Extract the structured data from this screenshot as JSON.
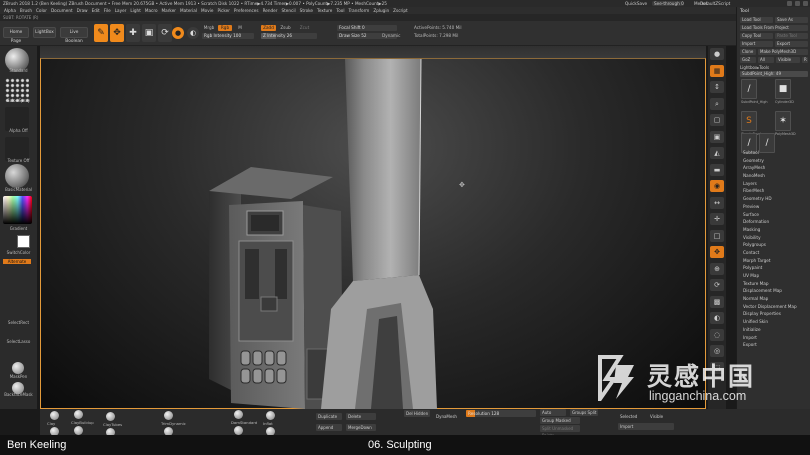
{
  "window": {
    "title": "ZBrush 2018 1.2 (Ben Keeling)  ZBrush Document  • Free Mem 20.675GB • Active Mem 1913 • Scratch Disk 1022 • RTime▶4.734 Timer▶0.007 • PolyCount▶7.235 MP • MeshCount▶25",
    "quicksave_label": "QuickSave",
    "seethrough_label": "See-through 0",
    "seethrough_fraction": 0,
    "menus_label": "Menus",
    "default_script_label": "DefaultZScript"
  },
  "menubar": {
    "items": [
      "Alpha",
      "Brush",
      "Color",
      "Document",
      "Draw",
      "Edit",
      "File",
      "Layer",
      "Light",
      "Macro",
      "Marker",
      "Material",
      "Movie",
      "Picker",
      "Preferences",
      "Render",
      "Stencil",
      "Stroke",
      "Texture",
      "Tool",
      "Transform",
      "Zplugin",
      "Zscript"
    ]
  },
  "substrip_label": "SUBT: ROTATE (R)",
  "toolbar": {
    "home_page_label": "Home Page",
    "lightbox_label": "LightBox",
    "live_boolean_label": "Live Boolean",
    "edit_label": "Edit",
    "draw_label": "Draw",
    "move_label": "Move",
    "scale_label": "Scale",
    "rotate_label": "Rotate",
    "mrgb_label": "Mrgb",
    "rgb_label": "Rgb",
    "m_label": "M",
    "zadd_label": "Zadd",
    "zsub_label": "Zsub",
    "zcut_label": "Zcut",
    "rgb_intensity": "Rgb Intensity 100",
    "z_intensity": "Z Intensity 26",
    "z_intensity_fraction": 0.26,
    "focal_shift": "Focal Shift 0",
    "draw_size": "Draw Size 52",
    "dynamic_label": "Dynamic",
    "active_points": "ActivePoints: 5.740 Mil",
    "total_points": "TotalPoints: 7.298 Mil"
  },
  "left_panel": {
    "brush_name": "Standard",
    "stroke_name": "Color Spray",
    "alpha_name": "Alpha Off",
    "texture_name": "Texture Off",
    "material_name": "BasicMaterial",
    "gradient_label": "Gradient",
    "switch_color_label": "SwitchColor",
    "alternate_label": "Alternate",
    "select_rect_label": "SelectRect",
    "select_lasso_label": "SelectLasso",
    "maskpen_label": "MaskPen",
    "backface_mask_label": "BackfaceMask"
  },
  "right_shelf": {
    "buttons": [
      "BPR",
      "SPix 3",
      "Scroll",
      "Zoom",
      "Actual",
      "AAHalf",
      "Persp",
      "Floor",
      "Local",
      "L.Sym",
      "XYZ",
      "Frame",
      "Move",
      "Zoom3D",
      "Rotate",
      "Line Fill PolyF",
      "Transp",
      "Ghost",
      "Solo",
      "Xpose"
    ]
  },
  "tool_tray": {
    "header": "Tool",
    "buttons": [
      "Load Tool",
      "Save As",
      "Load Tools From Project",
      "Copy Tool",
      "Paste Tool",
      "Import",
      "Export",
      "Clone",
      "Make PolyMesh3D",
      "GoZ",
      "All",
      "Visible",
      "R"
    ],
    "lightbox_tools_label": "Lightbox▸Tools",
    "current_tool": "SubdPoint_High: 49",
    "tool_thumbs": [
      {
        "label": "SubdPoint_High",
        "icon": "∕",
        "orange": false
      },
      {
        "label": "Cylinder3D",
        "icon": "■",
        "orange": false
      },
      {
        "label": "SimpleBrush",
        "icon": "S",
        "orange": true
      },
      {
        "label": "PolyMesh3D",
        "icon": "✶",
        "orange": false
      },
      {
        "label": "SubdPoint_High",
        "icon": "∕",
        "orange": false
      },
      {
        "label": "SubdPoint_High",
        "icon": "∕",
        "orange": false
      }
    ],
    "menu": [
      "Subtool",
      "Geometry",
      "ArrayMesh",
      "NanoMesh",
      "Layers",
      "FiberMesh",
      "Geometry HD",
      "Preview",
      "Surface",
      "Deformation",
      "Masking",
      "Visibility",
      "Polygroups",
      "Contact",
      "Morph Target",
      "Polypaint",
      "UV Map",
      "Texture Map",
      "Displacement Map",
      "Normal Map",
      "Vector Displacement Map",
      "Display Properties",
      "Unified Skin",
      "Initialize",
      "Import",
      "Export"
    ]
  },
  "bottom_shelf": {
    "brushes": [
      "Clay",
      "ClayBuildup",
      "ClayTubes",
      "TrimDynamic",
      "DamStandard",
      "Inflat"
    ],
    "duplicate_label": "Duplicate",
    "delete_label": "Delete",
    "append_label": "Append",
    "merge_down_label": "MergeDown",
    "del_hidden_label": "Del Hidden",
    "dynamesh_label": "DynaMesh",
    "resolution": "Resolution 128",
    "resolution_fraction": 0.125,
    "auto_groups_label": "Auto Groups",
    "groups_split_label": "Groups Split",
    "group_masked_label": "Group Masked",
    "split_unmasked_label": "Split Unmasked Points",
    "selected_label": "Selected",
    "visible_label": "Visible",
    "import_label": "Import"
  },
  "caption": {
    "author": "Ben Keeling",
    "lesson": "06. Sculpting"
  },
  "watermark": {
    "cn_text": "灵感中国",
    "url": "lingganchina.com"
  },
  "colors": {
    "accent_orange": "#f08a1c",
    "viewport_border": "#e39a3a",
    "ui_background": "#2f2f2f"
  }
}
